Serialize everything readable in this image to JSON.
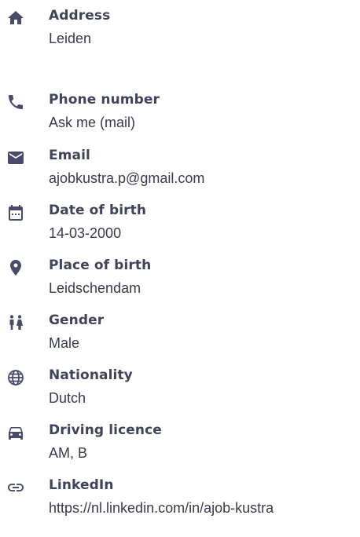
{
  "icon_color": "#4a4a6a",
  "label_color": "#42425a",
  "value_color": "#3a3a4e",
  "items": [
    {
      "label": "Address",
      "value": "Leiden",
      "icon": "home-icon"
    },
    {
      "label": "Phone number",
      "value": "Ask me (mail)",
      "icon": "phone-icon"
    },
    {
      "label": "Email",
      "value": "ajobkustra.p@gmail.com",
      "icon": "mail-icon"
    },
    {
      "label": "Date of birth",
      "value": "14-03-2000",
      "icon": "calendar-icon"
    },
    {
      "label": "Place of birth",
      "value": "Leidschendam",
      "icon": "location-pin-icon"
    },
    {
      "label": "Gender",
      "value": "Male",
      "icon": "people-icon"
    },
    {
      "label": "Nationality",
      "value": "Dutch",
      "icon": "globe-icon"
    },
    {
      "label": "Driving licence",
      "value": "AM, B",
      "icon": "car-icon"
    },
    {
      "label": "LinkedIn",
      "value": "https://nl.linkedin.com/in/ajob-kustra",
      "icon": "link-icon"
    }
  ]
}
